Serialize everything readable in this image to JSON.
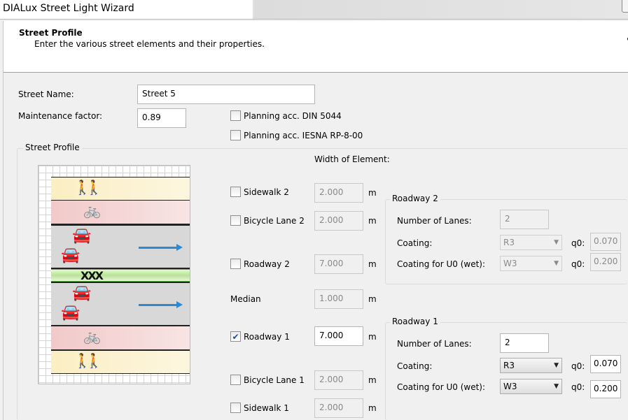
{
  "window": {
    "title": "DIALux Street Light Wizard"
  },
  "header": {
    "title": "Street Profile",
    "subtitle": "Enter the various street elements and their properties.",
    "edge_mark": "'"
  },
  "form": {
    "street_name_label": "Street Name:",
    "street_name_value": "Street 5",
    "maintenance_label": "Maintenance factor:",
    "maintenance_value": "0.89",
    "din_label": "Planning acc. DIN 5044",
    "din_checked": false,
    "iesna_label": "Planning acc. IESNA RP-8-00",
    "iesna_checked": false
  },
  "profile": {
    "group_title": "Street Profile",
    "width_header": "Width of Element:",
    "unit": "m",
    "elements": [
      {
        "key": "sidewalk2",
        "label": "Sidewalk 2",
        "checkbox": true,
        "checked": false,
        "width": "2.000",
        "enabled": false
      },
      {
        "key": "bicycle2",
        "label": "Bicycle Lane 2",
        "checkbox": true,
        "checked": false,
        "width": "2.000",
        "enabled": false
      },
      {
        "key": "roadway2",
        "label": "Roadway 2",
        "checkbox": true,
        "checked": false,
        "width": "7.000",
        "enabled": false
      },
      {
        "key": "median",
        "label": "Median",
        "checkbox": false,
        "checked": false,
        "width": "1.000",
        "enabled": false
      },
      {
        "key": "roadway1",
        "label": "Roadway 1",
        "checkbox": true,
        "checked": true,
        "width": "7.000",
        "enabled": true
      },
      {
        "key": "bicycle1",
        "label": "Bicycle Lane 1",
        "checkbox": true,
        "checked": false,
        "width": "2.000",
        "enabled": false
      },
      {
        "key": "sidewalk1",
        "label": "Sidewalk 1",
        "checkbox": true,
        "checked": false,
        "width": "2.000",
        "enabled": false
      }
    ]
  },
  "roadway2": {
    "title": "Roadway 2",
    "lanes_label": "Number of Lanes:",
    "lanes_value": "2",
    "coating_label": "Coating:",
    "coating_value": "R3",
    "q0_label": "q0:",
    "q0_value": "0.070",
    "coating_u0_label": "Coating for U0 (wet):",
    "coating_u0_value": "W3",
    "q0_u0_value": "0.200",
    "enabled": false
  },
  "roadway1": {
    "title": "Roadway 1",
    "lanes_label": "Number of Lanes:",
    "lanes_value": "2",
    "coating_label": "Coating:",
    "coating_value": "R3",
    "q0_label": "q0:",
    "q0_value": "0.070",
    "coating_u0_label": "Coating for U0 (wet):",
    "coating_u0_value": "W3",
    "q0_u0_value": "0.200",
    "enabled": true
  },
  "diagram_icons": {
    "pedestrian": "pedestrian-icon",
    "bicycle": "bicycle-icon",
    "car": "car-icon",
    "direction": "direction-arrow-icon",
    "median_barrier": "barrier-icon"
  },
  "colors": {
    "sidewalk": "#fbeec4",
    "bicycle_lane": "#f2c9c9",
    "roadway": "#d8d8d8",
    "median": "#b9e29a",
    "direction_arrow": "#2a8ad6",
    "check_mark": "#1a4e9b"
  }
}
